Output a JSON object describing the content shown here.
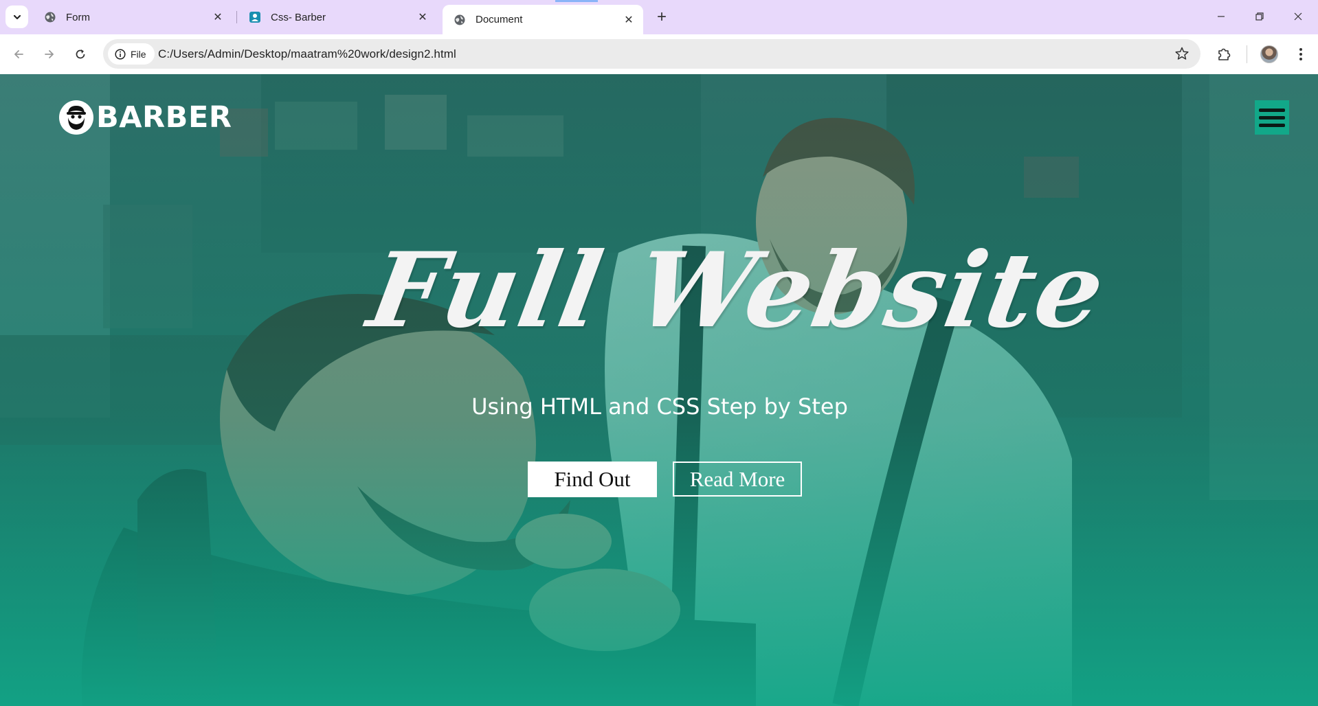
{
  "browser": {
    "tabs": [
      {
        "title": "Form",
        "icon": "globe-icon"
      },
      {
        "title": "Css- Barber",
        "icon": "contact-card-icon"
      },
      {
        "title": "Document",
        "icon": "globe-icon",
        "active": true
      }
    ],
    "address": {
      "chip_label": "File",
      "url": "C:/Users/Admin/Desktop/maatram%20work/design2.html"
    }
  },
  "page": {
    "logo_text": "BARBER",
    "hero_title": "Full Website",
    "hero_subtitle": "Using HTML and CSS Step by Step",
    "buttons": {
      "primary": "Find Out",
      "secondary": "Read More"
    },
    "colors": {
      "accent": "#12a889",
      "overlay": "#14a385"
    }
  }
}
